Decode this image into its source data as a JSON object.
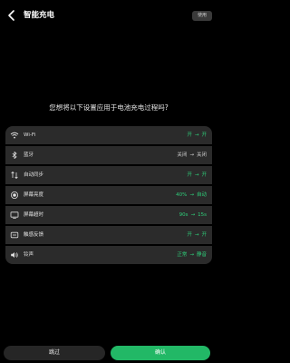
{
  "header": {
    "title": "智能充电",
    "use_label": "使用"
  },
  "question": "您想将以下设置应用于电池充电过程吗?",
  "settings": [
    {
      "label": "Wi-Fi",
      "icon": "wifi-icon",
      "from": "开",
      "to": "开",
      "tone": "green"
    },
    {
      "label": "蓝牙",
      "icon": "bluetooth-icon",
      "from": "关闭",
      "to": "关闭",
      "tone": "grey"
    },
    {
      "label": "自动同步",
      "icon": "sync-icon",
      "from": "开",
      "to": "开",
      "tone": "green"
    },
    {
      "label": "屏幕亮度",
      "icon": "brightness-icon",
      "from": "40%",
      "to": "自动",
      "tone": "green"
    },
    {
      "label": "屏幕超时",
      "icon": "timeout-icon",
      "from": "90s",
      "to": "15s",
      "tone": "green"
    },
    {
      "label": "触感反馈",
      "icon": "haptic-icon",
      "from": "开",
      "to": "开",
      "tone": "green"
    },
    {
      "label": "铃声",
      "icon": "sound-icon",
      "from": "正常",
      "to": "静音",
      "tone": "green"
    }
  ],
  "actions": {
    "skip_label": "跳过",
    "confirm_label": "确认"
  },
  "colors": {
    "accent": "#22b866",
    "value_green": "#2fcf7a",
    "row_bg": "#2b2b2b",
    "background": "#000000"
  }
}
